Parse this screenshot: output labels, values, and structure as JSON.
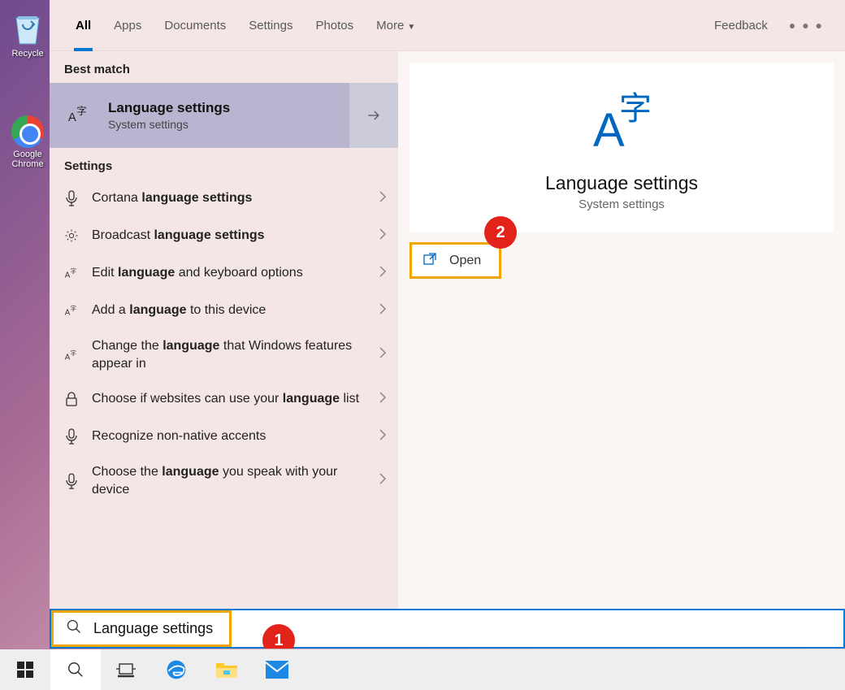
{
  "desktop": {
    "recycle_bin": "Recycle",
    "chrome": "Google Chrome"
  },
  "tabs": {
    "all": "All",
    "apps": "Apps",
    "documents": "Documents",
    "settings": "Settings",
    "photos": "Photos",
    "more": "More",
    "feedback": "Feedback"
  },
  "sections": {
    "best_match": "Best match",
    "settings": "Settings"
  },
  "best_match": {
    "title": "Language settings",
    "subtitle": "System settings"
  },
  "results": [
    {
      "icon": "mic",
      "pre": "Cortana ",
      "bold": "language settings",
      "post": ""
    },
    {
      "icon": "gear",
      "pre": "Broadcast ",
      "bold": "language settings",
      "post": ""
    },
    {
      "icon": "lang",
      "pre": "Edit ",
      "bold": "language",
      "post": " and keyboard options"
    },
    {
      "icon": "lang",
      "pre": "Add a ",
      "bold": "language",
      "post": " to this device"
    },
    {
      "icon": "lang",
      "pre": "Change the ",
      "bold": "language",
      "post": " that Windows features appear in"
    },
    {
      "icon": "lock",
      "pre": "Choose if websites can use your ",
      "bold": "language",
      "post": " list"
    },
    {
      "icon": "mic",
      "pre": "Recognize non-native accents",
      "bold": "",
      "post": ""
    },
    {
      "icon": "mic",
      "pre": "Choose the ",
      "bold": "language",
      "post": " you speak with your device"
    }
  ],
  "detail": {
    "title": "Language settings",
    "subtitle": "System settings",
    "open": "Open"
  },
  "search": {
    "value": "Language settings"
  },
  "badges": {
    "one": "1",
    "two": "2"
  }
}
